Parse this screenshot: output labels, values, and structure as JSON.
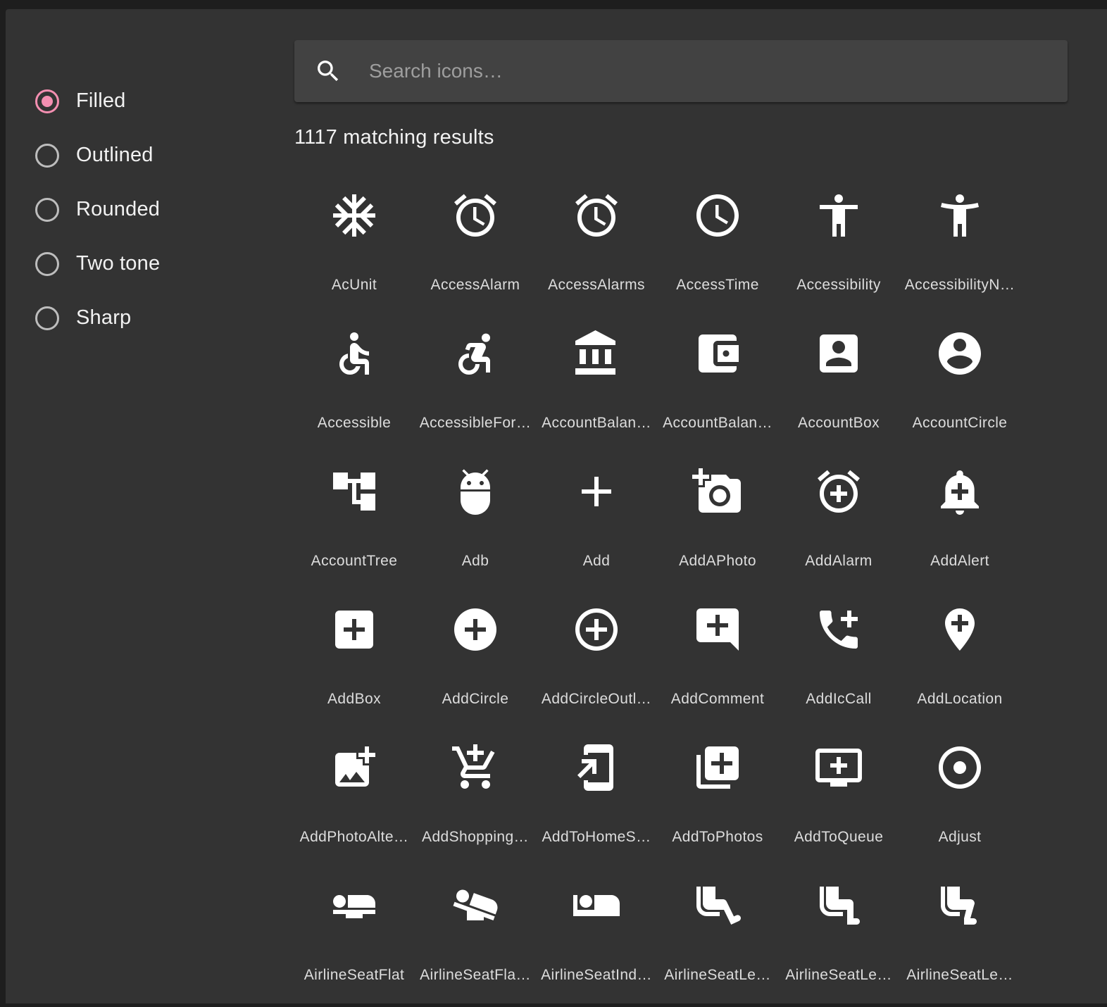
{
  "filters": {
    "options": [
      {
        "label": "Filled",
        "checked": true
      },
      {
        "label": "Outlined",
        "checked": false
      },
      {
        "label": "Rounded",
        "checked": false
      },
      {
        "label": "Two tone",
        "checked": false
      },
      {
        "label": "Sharp",
        "checked": false
      }
    ]
  },
  "search": {
    "placeholder": "Search icons…",
    "value": "",
    "icon": "search-icon"
  },
  "results": {
    "count_text": "1117 matching results"
  },
  "icons": [
    {
      "label": "AcUnit",
      "icon": "ac-unit-icon"
    },
    {
      "label": "AccessAlarm",
      "icon": "access-alarm-icon"
    },
    {
      "label": "AccessAlarms",
      "icon": "access-alarms-icon"
    },
    {
      "label": "AccessTime",
      "icon": "access-time-icon"
    },
    {
      "label": "Accessibility",
      "icon": "accessibility-icon"
    },
    {
      "label": "AccessibilityN…",
      "icon": "accessibility-new-icon"
    },
    {
      "label": "Accessible",
      "icon": "accessible-icon"
    },
    {
      "label": "AccessibleFor…",
      "icon": "accessible-forward-icon"
    },
    {
      "label": "AccountBalan…",
      "icon": "account-balance-icon"
    },
    {
      "label": "AccountBalan…",
      "icon": "account-balance-wallet-icon"
    },
    {
      "label": "AccountBox",
      "icon": "account-box-icon"
    },
    {
      "label": "AccountCircle",
      "icon": "account-circle-icon"
    },
    {
      "label": "AccountTree",
      "icon": "account-tree-icon"
    },
    {
      "label": "Adb",
      "icon": "adb-icon"
    },
    {
      "label": "Add",
      "icon": "add-icon"
    },
    {
      "label": "AddAPhoto",
      "icon": "add-a-photo-icon"
    },
    {
      "label": "AddAlarm",
      "icon": "add-alarm-icon"
    },
    {
      "label": "AddAlert",
      "icon": "add-alert-icon"
    },
    {
      "label": "AddBox",
      "icon": "add-box-icon"
    },
    {
      "label": "AddCircle",
      "icon": "add-circle-icon"
    },
    {
      "label": "AddCircleOutl…",
      "icon": "add-circle-outline-icon"
    },
    {
      "label": "AddComment",
      "icon": "add-comment-icon"
    },
    {
      "label": "AddIcCall",
      "icon": "add-ic-call-icon"
    },
    {
      "label": "AddLocation",
      "icon": "add-location-icon"
    },
    {
      "label": "AddPhotoAlte…",
      "icon": "add-photo-alternate-icon"
    },
    {
      "label": "AddShopping…",
      "icon": "add-shopping-cart-icon"
    },
    {
      "label": "AddToHomeS…",
      "icon": "add-to-home-screen-icon"
    },
    {
      "label": "AddToPhotos",
      "icon": "add-to-photos-icon"
    },
    {
      "label": "AddToQueue",
      "icon": "add-to-queue-icon"
    },
    {
      "label": "Adjust",
      "icon": "adjust-icon"
    },
    {
      "label": "AirlineSeatFlat",
      "icon": "airline-seat-flat-icon"
    },
    {
      "label": "AirlineSeatFla…",
      "icon": "airline-seat-flat-angled-icon"
    },
    {
      "label": "AirlineSeatInd…",
      "icon": "airline-seat-individual-suite-icon"
    },
    {
      "label": "AirlineSeatLe…",
      "icon": "airline-seat-legroom-extra-icon"
    },
    {
      "label": "AirlineSeatLe…",
      "icon": "airline-seat-legroom-normal-icon"
    },
    {
      "label": "AirlineSeatLe…",
      "icon": "airline-seat-legroom-reduced-icon"
    }
  ]
}
